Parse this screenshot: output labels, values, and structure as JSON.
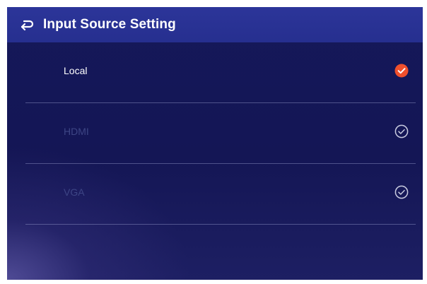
{
  "header": {
    "title": "Input Source Setting",
    "back_icon": "return-arrow-icon"
  },
  "sources": [
    {
      "label": "Local",
      "selected": true,
      "check_icon": "check-circle-filled-icon",
      "color": "#f0502d"
    },
    {
      "label": "HDMI",
      "selected": false,
      "check_icon": "check-circle-outline-icon",
      "color": "#c9cbe0"
    },
    {
      "label": "VGA",
      "selected": false,
      "check_icon": "check-circle-outline-icon",
      "color": "#c9cbe0"
    }
  ],
  "colors": {
    "header_bg": "#2a3396",
    "background": "#15185a",
    "selected_accent": "#f0502d"
  }
}
